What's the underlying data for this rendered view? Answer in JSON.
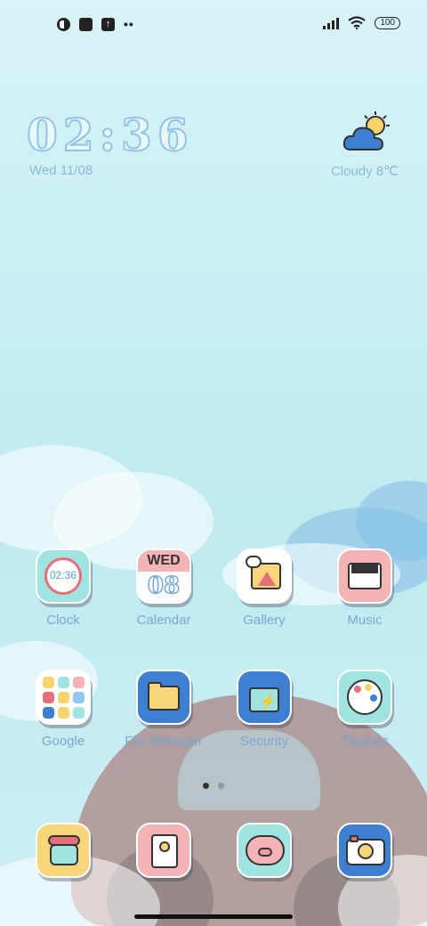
{
  "status_bar": {
    "left_icons": [
      "circle-half-icon",
      "square-icon",
      "upload-icon",
      "more-dots-icon"
    ],
    "more_dots": "••",
    "battery": "100"
  },
  "clock_widget": {
    "time": "02:36",
    "date": "Wed 11/08"
  },
  "weather_widget": {
    "condition_temp": "Cloudy  8℃",
    "icon": "cloud-sun-icon"
  },
  "apps_row1": [
    {
      "label": "Clock",
      "inner": "02:36"
    },
    {
      "label": "Calendar",
      "day": "WED",
      "date": "08"
    },
    {
      "label": "Gallery"
    },
    {
      "label": "Music"
    }
  ],
  "apps_row2": [
    {
      "label": "Google"
    },
    {
      "label": "File Manager"
    },
    {
      "label": "Security"
    },
    {
      "label": "Themes"
    }
  ],
  "dock": [
    {
      "name": "phone"
    },
    {
      "name": "contacts"
    },
    {
      "name": "messages"
    },
    {
      "name": "camera"
    }
  ],
  "pager": {
    "pages": 2,
    "active": 0
  },
  "colors": {
    "label": "#7aa6d6",
    "accent_blue": "#3d7fd1",
    "tile_mint": "#9fe4e0",
    "tile_pink": "#f4b4b6",
    "tile_yellow": "#f8d57a"
  }
}
